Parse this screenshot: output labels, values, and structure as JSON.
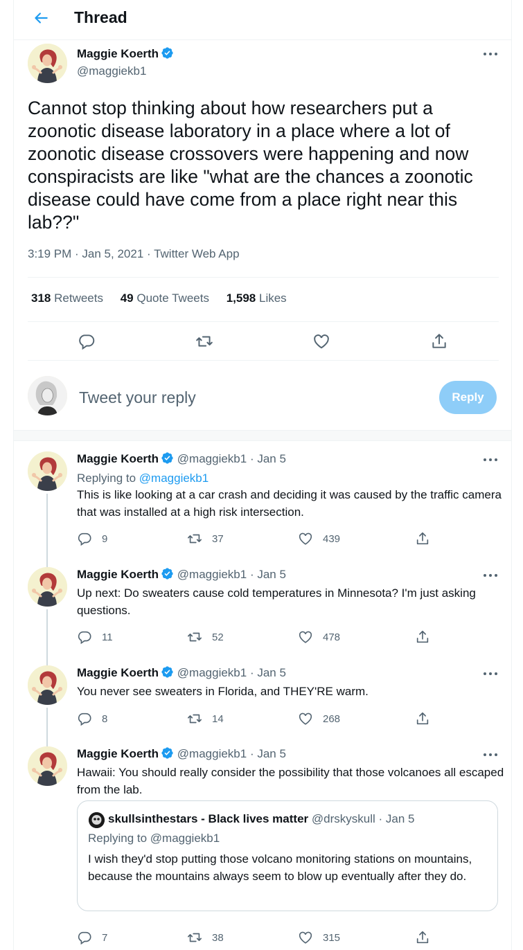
{
  "header": {
    "title": "Thread"
  },
  "main_tweet": {
    "author_name": "Maggie Koerth",
    "handle": "@maggiekb1",
    "text": "Cannot stop thinking about how researchers put a zoonotic disease laboratory in a place where a lot of zoonotic disease crossovers were happening and now conspiracists are like \"what are the chances a zoonotic disease could have come from a place right near this lab??\"",
    "meta": "3:19 PM · Jan 5, 2021 · Twitter Web App",
    "stats": {
      "retweets": "318",
      "retweets_label": "Retweets",
      "quotes": "49",
      "quotes_label": "Quote Tweets",
      "likes": "1,598",
      "likes_label": "Likes"
    }
  },
  "composer": {
    "placeholder": "Tweet your reply",
    "button_label": "Reply"
  },
  "replies": [
    {
      "author_name": "Maggie Koerth",
      "handle": "@maggiekb1",
      "time": "· Jan 5",
      "replying_prefix": "Replying to",
      "replying_to": "@maggiekb1",
      "text": "This is like looking at a car crash and deciding it was caused by the traffic camera that was installed at a high risk intersection.",
      "replies": "9",
      "retweets": "37",
      "likes": "439"
    },
    {
      "author_name": "Maggie Koerth",
      "handle": "@maggiekb1",
      "time": "· Jan 5",
      "text": "Up next: Do sweaters cause cold temperatures in Minnesota? I'm just asking questions.",
      "replies": "11",
      "retweets": "52",
      "likes": "478"
    },
    {
      "author_name": "Maggie Koerth",
      "handle": "@maggiekb1",
      "time": "· Jan 5",
      "text": "You never see sweaters in Florida, and THEY'RE warm.",
      "replies": "8",
      "retweets": "14",
      "likes": "268"
    },
    {
      "author_name": "Maggie Koerth",
      "handle": "@maggiekb1",
      "time": "· Jan 5",
      "text": "Hawaii: You should really consider the possibility that those volcanoes all escaped from the lab.",
      "replies": "7",
      "retweets": "38",
      "likes": "315",
      "quoted": {
        "author_name": "skullsinthestars - Black lives matter",
        "handle": "@drskyskull",
        "time": "· Jan 5",
        "replying_line": "Replying to @maggiekb1",
        "text": "I wish they'd stop putting those volcano monitoring stations on mountains, because the mountains always seem to blow up eventually after they do."
      }
    }
  ],
  "colors": {
    "accent": "#1d9bf0",
    "muted": "#536471",
    "reply_button_disabled": "#8ecdf8"
  }
}
